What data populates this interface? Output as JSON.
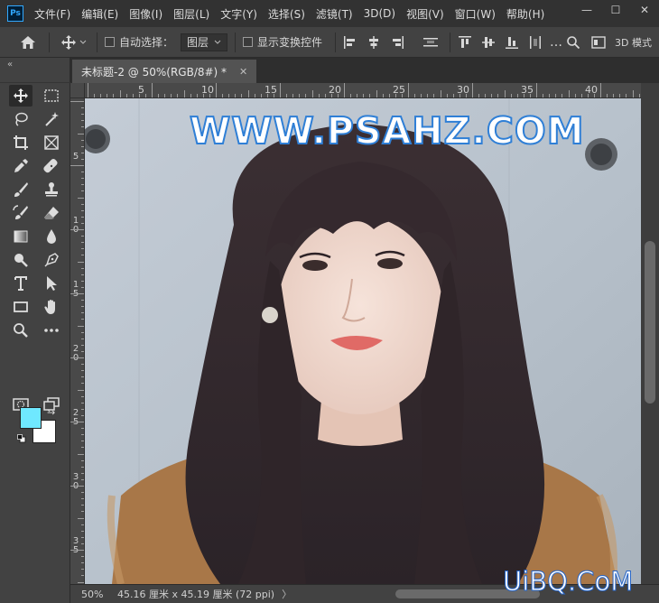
{
  "app": {
    "logo": "Ps"
  },
  "menu": [
    "文件(F)",
    "编辑(E)",
    "图像(I)",
    "图层(L)",
    "文字(Y)",
    "选择(S)",
    "滤镜(T)",
    "3D(D)",
    "视图(V)",
    "窗口(W)",
    "帮助(H)"
  ],
  "window_controls": {
    "minimize": "—",
    "maximize": "☐",
    "close": "✕"
  },
  "options": {
    "auto_select_label": "自动选择：",
    "auto_select_value": "图层",
    "show_transform_label": "显示变换控件",
    "mode_3d_label": "3D 模式"
  },
  "toolbar": {
    "collapse": "«"
  },
  "document": {
    "tab_title": "未标题-2 @ 50%(RGB/8#) *",
    "tab_close": "✕"
  },
  "ruler": {
    "top_labels": [
      "5",
      "10",
      "15",
      "20",
      "25",
      "30",
      "35",
      "40"
    ],
    "left_labels": [
      "5",
      "10",
      "15",
      "20",
      "25",
      "30",
      "35"
    ]
  },
  "canvas": {
    "watermark_top": "WWW.PSAHZ.COM"
  },
  "status": {
    "zoom": "50%",
    "doc_info": "45.16 厘米 x 45.19 厘米 (72 ppi)",
    "arrow": "〉"
  },
  "watermark_bottom": "UiBQ.CoM",
  "colors": {
    "foreground": "#6fe8ff",
    "background": "#ffffff",
    "panel": "#424242",
    "menubar": "#323232"
  }
}
